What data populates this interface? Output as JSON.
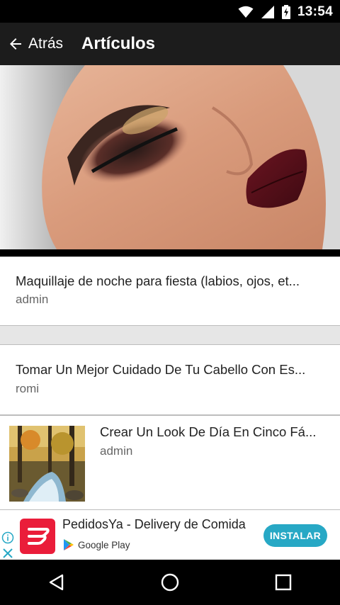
{
  "status_bar": {
    "time": "13:54",
    "icons": [
      "wifi-icon",
      "signal-icon",
      "battery-charging-icon"
    ]
  },
  "app_bar": {
    "back_label": "Atrás",
    "back_icon": "arrow-left-icon",
    "title": "Artículos"
  },
  "articles": [
    {
      "title": "Maquillaje de noche para fiesta (labios, ojos, et...",
      "author": "admin",
      "image": "makeup-hero-image"
    },
    {
      "title": "Tomar Un Mejor Cuidado De Tu Cabello Con Es...",
      "author": "romi"
    },
    {
      "title": "Crear Un Look De Día En Cinco Fá...",
      "author": "admin",
      "image": "forest-stream-thumbnail"
    }
  ],
  "ad": {
    "title": "PedidosYa - Delivery de Comida",
    "store": "Google Play",
    "install_label": "INSTALAR",
    "brand_color": "#ea1d3a",
    "button_color": "#27a8c5"
  },
  "nav_bar": {
    "buttons": [
      "back-triangle-icon",
      "home-circle-icon",
      "recents-square-icon"
    ]
  }
}
